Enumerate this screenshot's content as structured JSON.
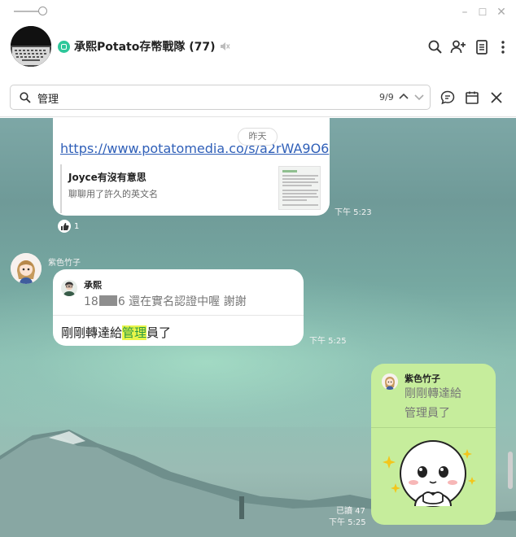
{
  "window": {
    "minimize_label": "–",
    "maximize_label": "☐",
    "close_label": "✕"
  },
  "header": {
    "group_name": "承熙Potato存幣戰隊 (77)"
  },
  "search": {
    "query": "管理",
    "result_count": "9/9"
  },
  "messages": {
    "link_message": {
      "url": "https://www.potatomedia.co/s/a2rWA9O6",
      "preview_title": "Joyce有沒有意思",
      "preview_desc": "聊聊用了許久的英文名",
      "date_chip": "昨天",
      "time": "下午 5:23",
      "reaction_count": "1"
    },
    "reply_message": {
      "sender": "紫色竹子",
      "quoted_sender": "承熙",
      "quoted_prefix": "18",
      "quoted_suffix": "6  還在實名認證中喔  謝謝",
      "text_before": "剛剛轉達給",
      "text_highlight": "管理",
      "text_after": "員了",
      "time": "下午 5:25"
    },
    "own_message": {
      "quoted_sender": "紫色竹子",
      "quoted_line1": "剛剛轉達給",
      "quoted_line2": "管理員了",
      "read_label": "已讀 47",
      "time": "下午 5:25",
      "sticker": "white-blob-sticker"
    }
  },
  "colors": {
    "bubble_green": "#c6ed9c",
    "link_blue": "#2f5fb8",
    "highlight": "#e9f54a",
    "badge_green": "#2ec79a"
  }
}
